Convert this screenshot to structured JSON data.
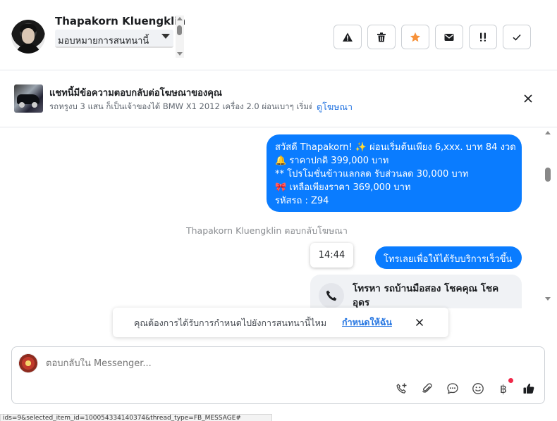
{
  "header": {
    "user_name": "Thapakorn Kluengklin",
    "assign_placeholder": "มอบหมายการสนทนานี้",
    "toolbar": [
      {
        "name": "mark-spam-button",
        "icon": "warning-icon"
      },
      {
        "name": "delete-button",
        "icon": "trash-icon"
      },
      {
        "name": "star-button",
        "icon": "star-icon"
      },
      {
        "name": "mark-unread-button",
        "icon": "envelope-icon"
      },
      {
        "name": "follow-up-button",
        "icon": "exclamation-icon"
      },
      {
        "name": "mark-done-button",
        "icon": "check-icon"
      }
    ],
    "star_color": "#f7923a"
  },
  "ad_banner": {
    "title": "แชทนี้มีข้อความตอบกลับต่อโฆษณาของคุณ",
    "subtitle": "รถหรูงบ 3 แสน ก็เป็นเจ้าของได้ BMW X1 2012 เครื่อง 2.0 ผ่อนเบาๆ เริ่มต้...",
    "link": "ดูโฆษณา"
  },
  "messages": {
    "greeting_lines": [
      "สวัสดี Thapakorn! ✨  ผ่อนเริ่มต้นเพียง 6,xxx. บาท 84 งวด",
      "🔔 ราคาปกติ 399,000 บาท",
      "** โปรโมชั่นข้าวแลกลด รับส่วนลด 30,000 บาท",
      "🎀  เหลือเพียงราคา 369,000 บาท",
      " รหัสรถ : Z94"
    ],
    "system_note": "Thapakorn Kluengklin ตอบกลับโฆษณา",
    "timestamp": "14:44",
    "cta_bubble": "โทรเลยเพื่อให้ได้รับบริการเร็วขึ้น",
    "call_card_text": "โทรหา รถบ้านมือสอง โชคคุณ โชคอุดร",
    "bubble_color": "#0a7cff"
  },
  "notice": {
    "text": "คุณต้องการได้รับการกำหนดไปยังการสนทนานี้ไหม",
    "link": "กำหนดให้ฉัน"
  },
  "composer": {
    "placeholder": "ตอบกลับใน Messenger...",
    "icons": [
      "add-call-icon",
      "attachment-icon",
      "saved-reply-icon",
      "emoji-icon",
      "payment-baht-icon",
      "thumbs-up-icon"
    ],
    "baht_symbol": "฿"
  },
  "status_bar": {
    "url": "ids=9&selected_item_id=100054334140374&thread_type=FB_MESSAGE#"
  }
}
